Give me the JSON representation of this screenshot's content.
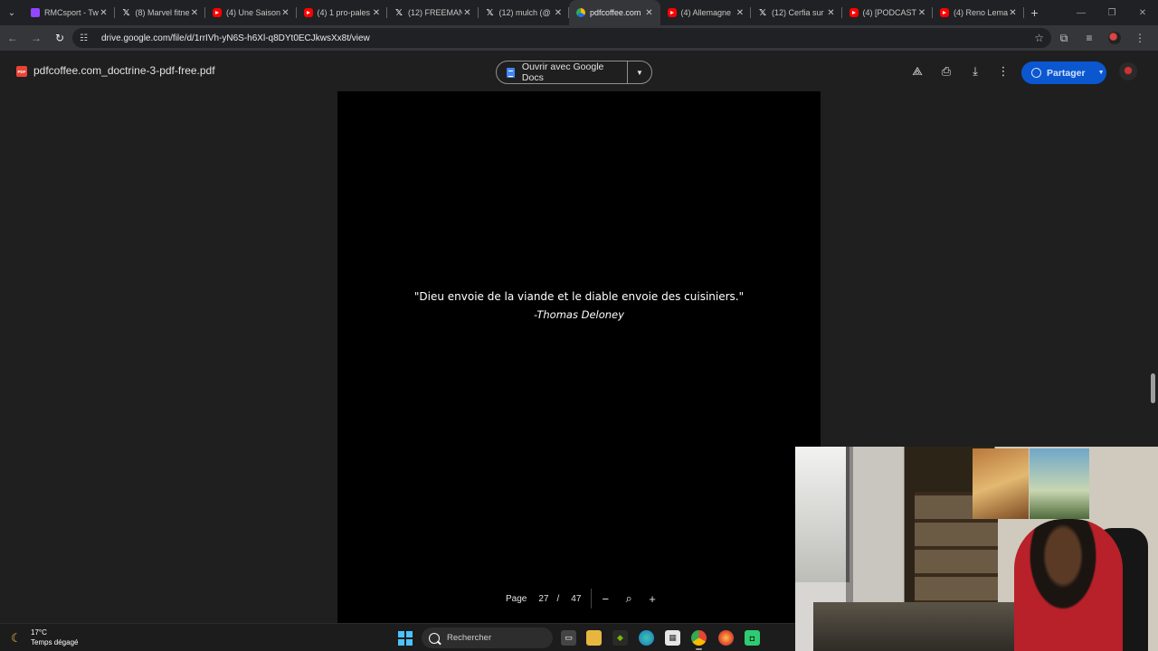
{
  "browser": {
    "tabs": [
      {
        "title": "RMCsport - Tw",
        "icon": "twitch-icon"
      },
      {
        "title": "(8) Marvel fitne",
        "icon": "x-icon"
      },
      {
        "title": "(4) Une Saison",
        "icon": "youtube-icon"
      },
      {
        "title": "(4) 1 pro-pales",
        "icon": "youtube-icon"
      },
      {
        "title": "(12) FREEMAN",
        "icon": "x-icon"
      },
      {
        "title": "(12) mulch (@",
        "icon": "x-icon"
      },
      {
        "title": "pdfcoffee.com",
        "icon": "drive-icon",
        "active": true
      },
      {
        "title": "(4) Allemagne",
        "icon": "youtube-icon"
      },
      {
        "title": "(12) Cerfia sur",
        "icon": "x-icon"
      },
      {
        "title": "(4) [PODCAST]",
        "icon": "youtube-icon"
      },
      {
        "title": "(4) Reno Lema",
        "icon": "youtube-icon"
      }
    ],
    "new_tab": "+",
    "url": "drive.google.com/file/d/1rrIVh-yN6S-h6Xl-q8DYt0ECJkwsXx8t/view"
  },
  "viewer": {
    "file_name": "pdfcoffee.com_doctrine-3-pdf-free.pdf",
    "file_icon_text": "PDF",
    "open_with": "Ouvrir avec Google Docs",
    "share": "Partager"
  },
  "document": {
    "quote": "\"Dieu envoie de la viande et le diable envoie des cuisiniers.\"",
    "author": "-Thomas Deloney"
  },
  "page_controls": {
    "label": "Page",
    "current": "27",
    "separator": "/",
    "total": "47",
    "zoom_out": "−",
    "zoom_in": "+"
  },
  "taskbar": {
    "temperature": "17°C",
    "weather": "Temps dégagé",
    "search_placeholder": "Rechercher"
  },
  "colors": {
    "accent": "#0b57d0",
    "pdf_red": "#ea4335",
    "background": "#1f1f1f"
  }
}
